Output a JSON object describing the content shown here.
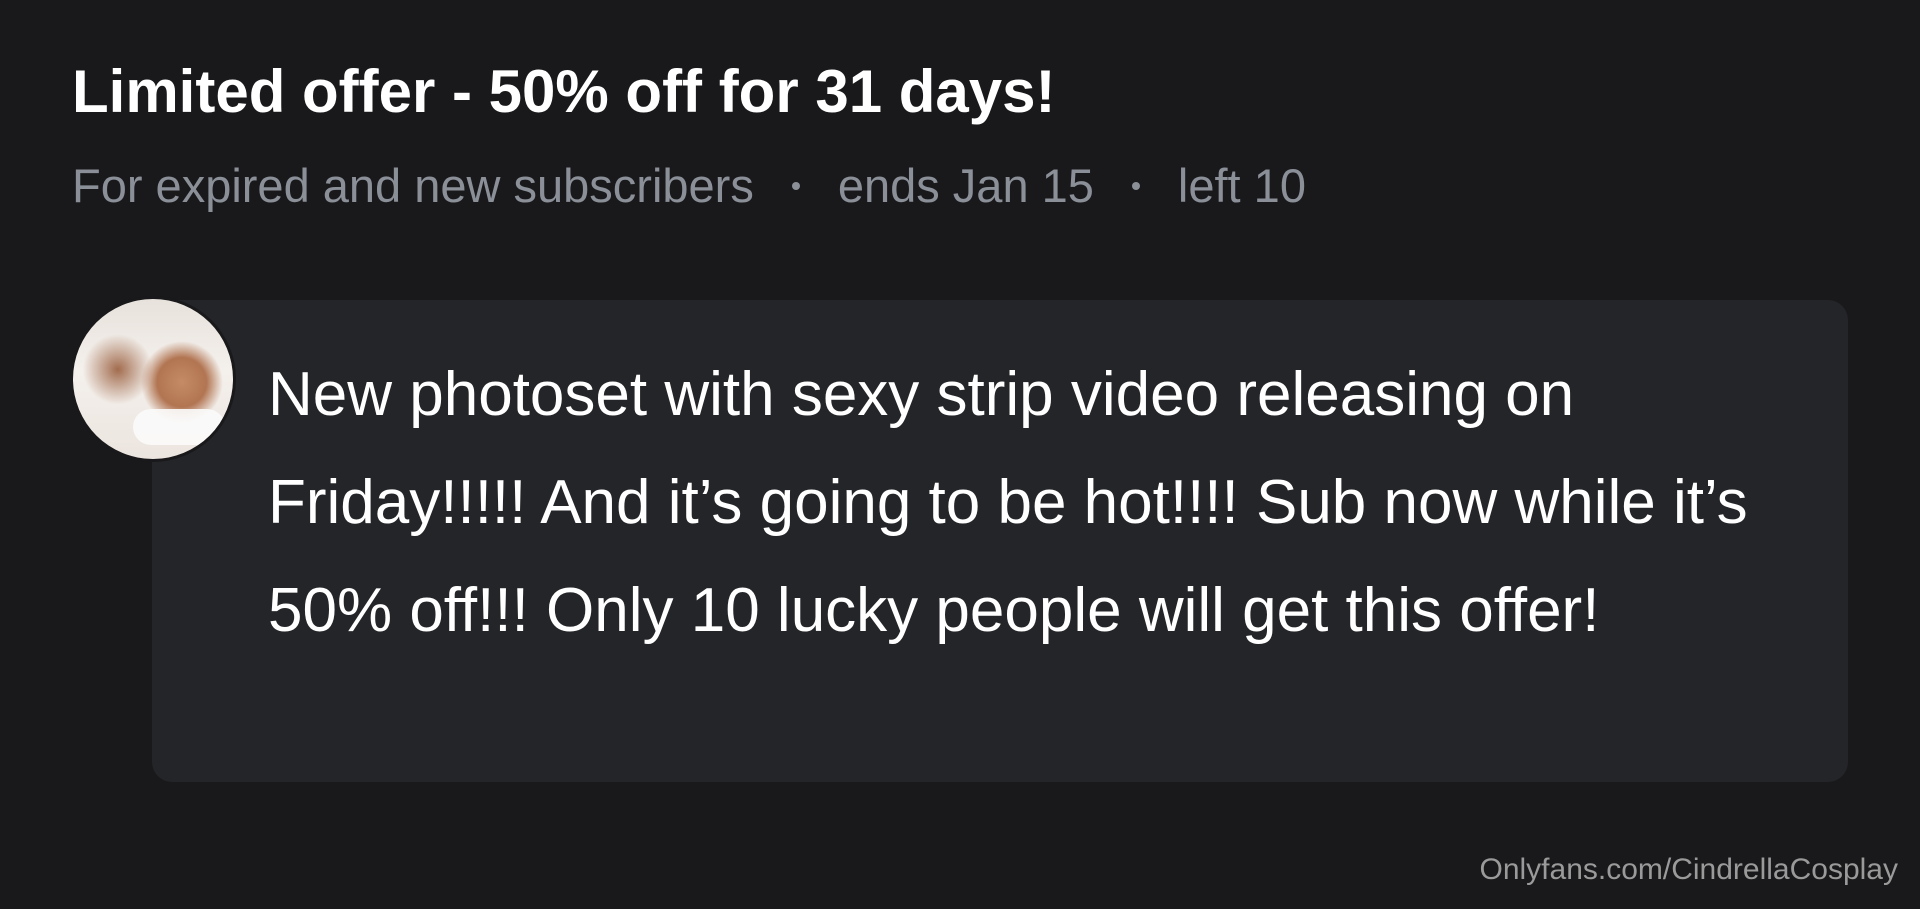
{
  "offer": {
    "title": "Limited offer - 50% off for 31 days!",
    "audience": "For expired and new subscribers",
    "ends": "ends Jan 15",
    "left": "left 10"
  },
  "message": {
    "text": "New photoset with sexy strip video releasing on Friday!!!!! And it’s going to be hot!!!! Sub now while it’s 50% off!!! Only 10 lucky people will get this offer!"
  },
  "watermark": "Onlyfans.com/CindrellaCosplay",
  "colors": {
    "background": "#19191b",
    "bubble": "#242528",
    "title": "#ffffff",
    "meta": "#8a8f98"
  }
}
